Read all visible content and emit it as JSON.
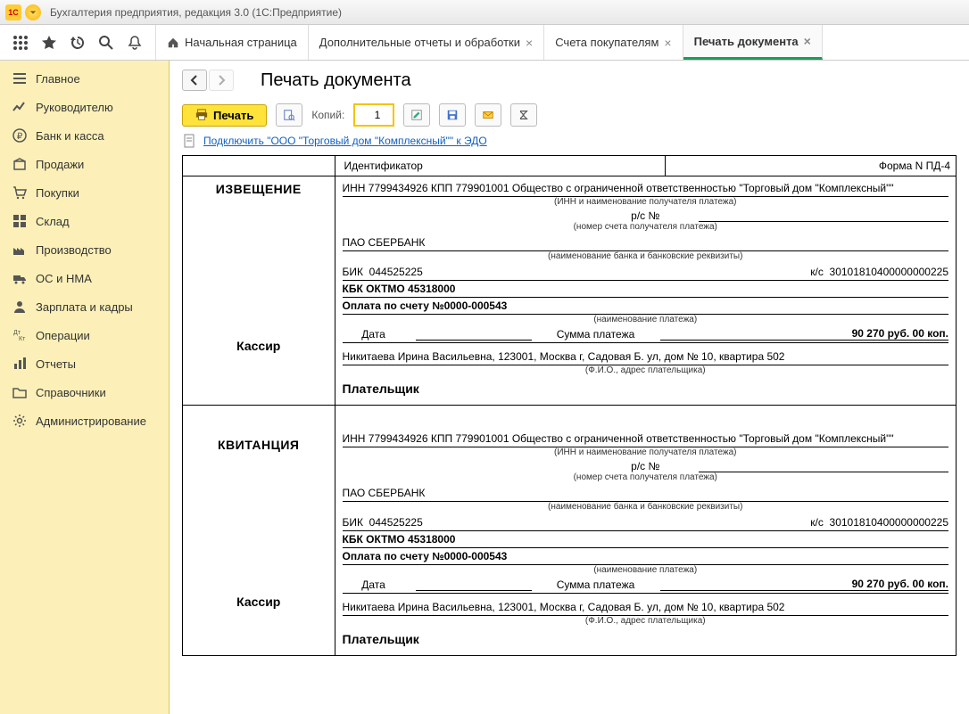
{
  "window": {
    "title": "Бухгалтерия предприятия, редакция 3.0  (1С:Предприятие)"
  },
  "tabs": [
    {
      "label": "Начальная страница",
      "closable": false,
      "icon": "home"
    },
    {
      "label": "Дополнительные отчеты и обработки",
      "closable": true
    },
    {
      "label": "Счета покупателям",
      "closable": true
    },
    {
      "label": "Печать документа",
      "closable": true,
      "active": true
    }
  ],
  "sidebar": [
    {
      "label": "Главное"
    },
    {
      "label": "Руководителю"
    },
    {
      "label": "Банк и касса"
    },
    {
      "label": "Продажи"
    },
    {
      "label": "Покупки"
    },
    {
      "label": "Склад"
    },
    {
      "label": "Производство"
    },
    {
      "label": "ОС и НМА"
    },
    {
      "label": "Зарплата и кадры"
    },
    {
      "label": "Операции"
    },
    {
      "label": "Отчеты"
    },
    {
      "label": "Справочники"
    },
    {
      "label": "Администрирование"
    }
  ],
  "page": {
    "title": "Печать документа",
    "printBtn": "Печать",
    "copiesLabel": "Копий:",
    "copiesValue": "1",
    "edoLink": "Подключить \"ООО \"Торговый дом \"Комплексный\"\" к ЭДО"
  },
  "doc": {
    "identifierLabel": "Идентификатор",
    "formNo": "Форма N ПД-4",
    "noticeTitle": "ИЗВЕЩЕНИЕ",
    "receiptTitle": "КВИТАНЦИЯ",
    "cashier": "Кассир",
    "payerLabel": "Плательщик",
    "inn": "ИНН 7799434926 КПП 779901001 Общество с ограниченной ответственностью \"Торговый дом \"Комплексный\"\"",
    "innCaption": "(ИНН и наименование получателя платежа)",
    "rsLabel": "р/с №",
    "rsCaption": "(номер счета получателя платежа)",
    "bank": "ПАО СБЕРБАНК",
    "bankCaption": "(наименование банка и банковские реквизиты)",
    "bikLabel": "БИК",
    "bikValue": "044525225",
    "ksLabel": "к/с",
    "ksValue": "30101810400000000225",
    "kbk": "КБК  ОКТМО 45318000",
    "payPurpose": "Оплата по счету №0000-000543",
    "purposeCaption": "(наименование платежа)",
    "dateLabel": "Дата",
    "sumLabel": "Сумма платежа",
    "sumValue": "90 270 руб. 00 коп.",
    "payer": "Никитаева Ирина Васильевна, 123001, Москва г, Садовая Б. ул, дом № 10, квартира 502",
    "payerCaption": "(Ф.И.О., адрес плательщика)"
  }
}
